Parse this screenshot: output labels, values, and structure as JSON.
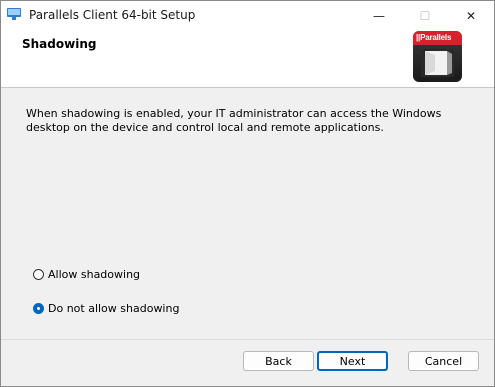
{
  "window": {
    "title": "Parallels Client 64-bit Setup"
  },
  "caption": {
    "minimize": "—",
    "maximize": "☐",
    "close": "✕"
  },
  "header": {
    "title": "Shadowing",
    "logo_text": "||Parallels"
  },
  "description": "When shadowing is enabled, your IT administrator can access the Windows desktop on the device and control local and remote applications.",
  "options": [
    {
      "label": "Allow shadowing",
      "selected": false
    },
    {
      "label": "Do not allow shadowing",
      "selected": true
    }
  ],
  "buttons": {
    "back": "Back",
    "next": "Next",
    "cancel": "Cancel"
  },
  "colors": {
    "accent": "#0067c0",
    "logo_red": "#d5222c",
    "background": "#f0f0f0"
  }
}
